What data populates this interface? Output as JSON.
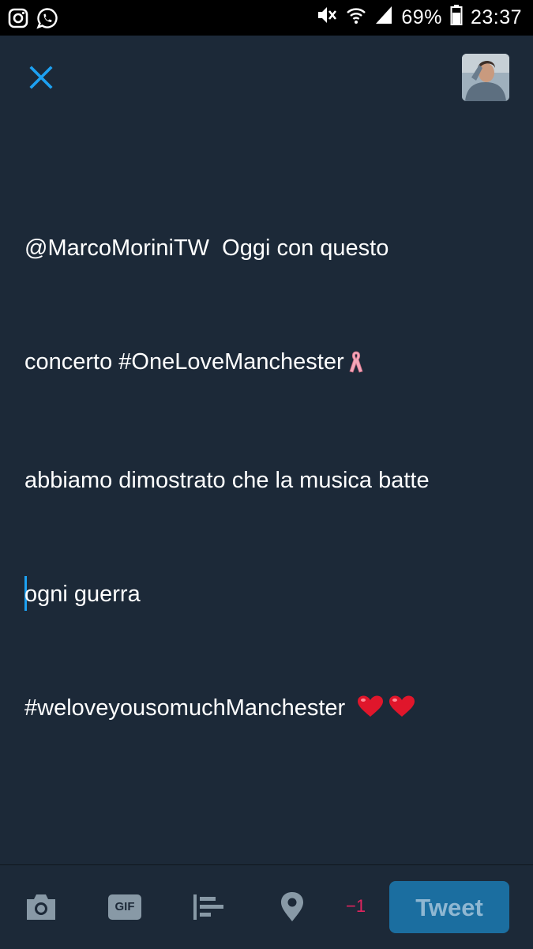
{
  "status_bar": {
    "battery_percent": "69%",
    "time": "23:37",
    "icons": [
      "instagram-icon",
      "whatsapp-icon",
      "mute-icon",
      "wifi-icon",
      "signal-icon",
      "battery-icon"
    ]
  },
  "header": {
    "close_icon": "close-icon",
    "avatar_alt": "profile-avatar"
  },
  "compose": {
    "line1": "@MarcoMoriniTW  Oggi con questo",
    "line2_text": "concerto #OneLoveManchester",
    "line3": "abbiamo dimostrato che la musica batte",
    "line4": "ogni guerra",
    "line5_text": "#weloveyousomuchManchester",
    "emoji": [
      "ribbon-emoji",
      "heart-emoji",
      "heart-emoji"
    ]
  },
  "toolbar": {
    "icons": [
      "camera-icon",
      "gif-icon",
      "poll-icon",
      "location-icon"
    ],
    "gif_label": "GIF",
    "char_count": "−1",
    "tweet_label": "Tweet"
  },
  "colors": {
    "background": "#1c2938",
    "accent": "#1da1f2",
    "tweet_button": "#1b6ea0",
    "warning": "#e0245e"
  }
}
